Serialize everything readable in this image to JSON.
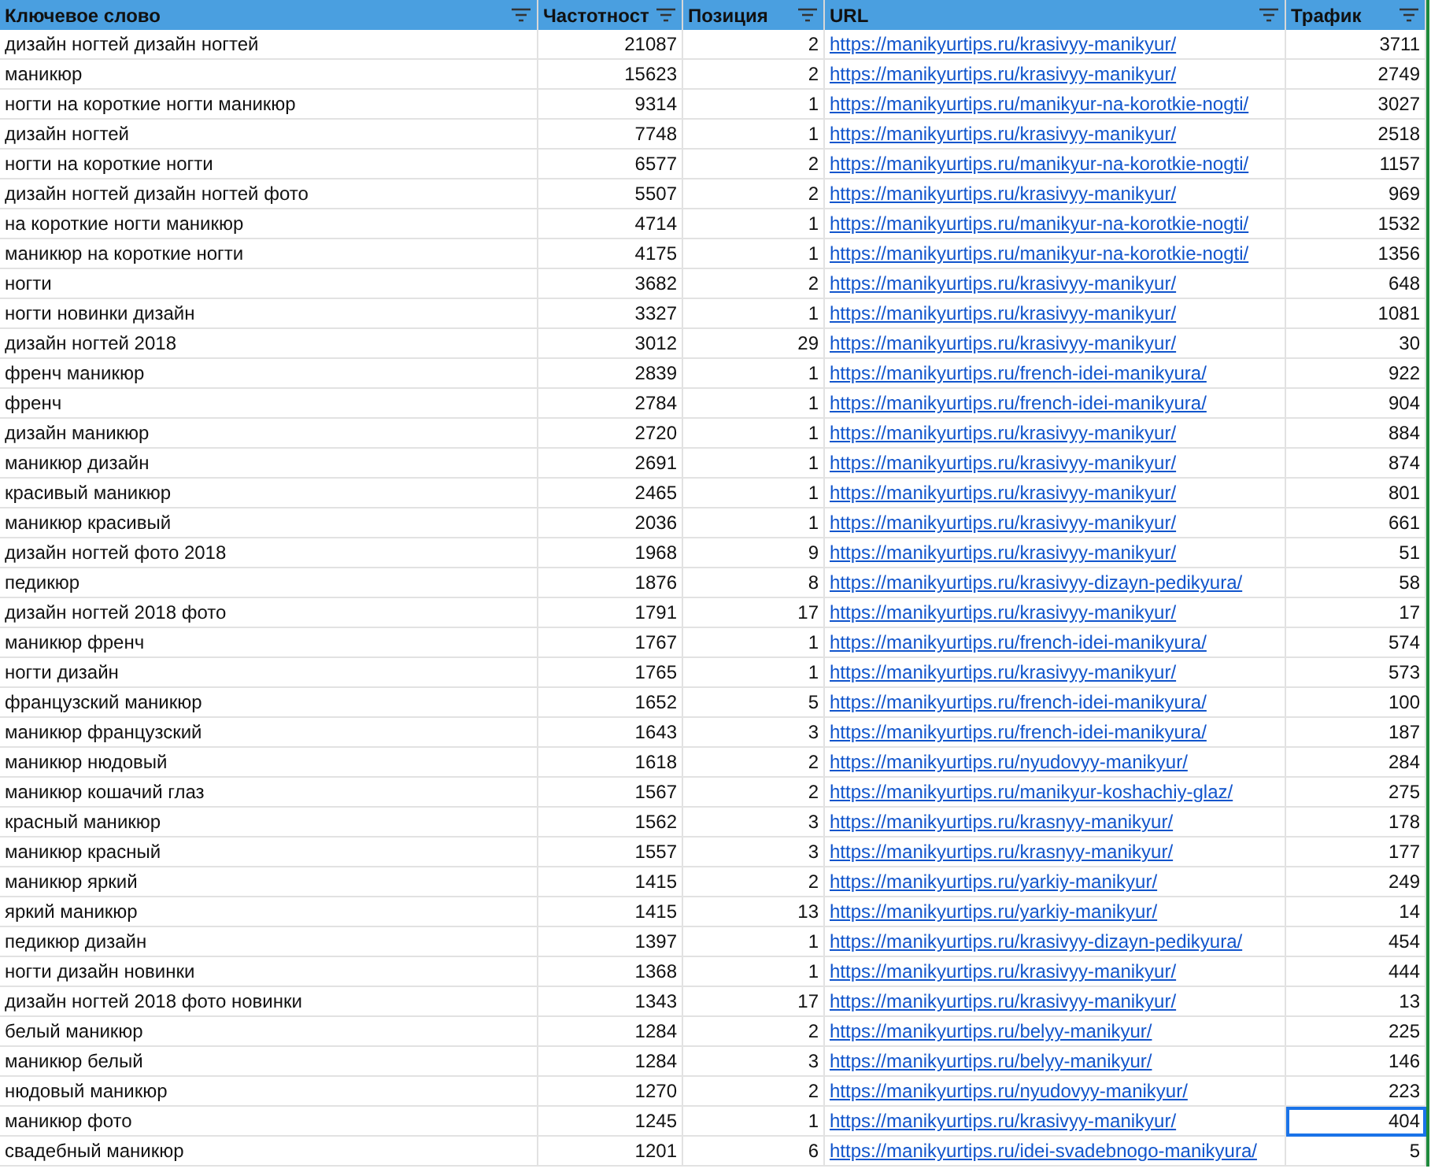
{
  "columns": [
    {
      "label": "Ключевое слово",
      "kind": "text"
    },
    {
      "label": "Частотност",
      "kind": "number"
    },
    {
      "label": "Позиция",
      "kind": "number"
    },
    {
      "label": "URL",
      "kind": "link"
    },
    {
      "label": "Трафик",
      "kind": "number"
    }
  ],
  "rows": [
    {
      "cells": [
        "дизайн ногтей дизайн ногтей",
        "21087",
        "2",
        "https://manikyurtips.ru/krasivyy-manikyur/",
        "3711"
      ],
      "selected": false
    },
    {
      "cells": [
        "маникюр",
        "15623",
        "2",
        "https://manikyurtips.ru/krasivyy-manikyur/",
        "2749"
      ],
      "selected": false
    },
    {
      "cells": [
        "ногти на короткие ногти маникюр",
        "9314",
        "1",
        "https://manikyurtips.ru/manikyur-na-korotkie-nogti/",
        "3027"
      ],
      "selected": false
    },
    {
      "cells": [
        "дизайн ногтей",
        "7748",
        "1",
        "https://manikyurtips.ru/krasivyy-manikyur/",
        "2518"
      ],
      "selected": false
    },
    {
      "cells": [
        "ногти на короткие ногти",
        "6577",
        "2",
        "https://manikyurtips.ru/manikyur-na-korotkie-nogti/",
        "1157"
      ],
      "selected": false
    },
    {
      "cells": [
        "дизайн ногтей дизайн ногтей фото",
        "5507",
        "2",
        "https://manikyurtips.ru/krasivyy-manikyur/",
        "969"
      ],
      "selected": false
    },
    {
      "cells": [
        "на короткие ногти маникюр",
        "4714",
        "1",
        "https://manikyurtips.ru/manikyur-na-korotkie-nogti/",
        "1532"
      ],
      "selected": false
    },
    {
      "cells": [
        "маникюр на короткие ногти",
        "4175",
        "1",
        "https://manikyurtips.ru/manikyur-na-korotkie-nogti/",
        "1356"
      ],
      "selected": false
    },
    {
      "cells": [
        "ногти",
        "3682",
        "2",
        "https://manikyurtips.ru/krasivyy-manikyur/",
        "648"
      ],
      "selected": false
    },
    {
      "cells": [
        "ногти новинки дизайн",
        "3327",
        "1",
        "https://manikyurtips.ru/krasivyy-manikyur/",
        "1081"
      ],
      "selected": false
    },
    {
      "cells": [
        "дизайн ногтей 2018",
        "3012",
        "29",
        "https://manikyurtips.ru/krasivyy-manikyur/",
        "30"
      ],
      "selected": false
    },
    {
      "cells": [
        "френч маникюр",
        "2839",
        "1",
        "https://manikyurtips.ru/french-idei-manikyura/",
        "922"
      ],
      "selected": false
    },
    {
      "cells": [
        "френч",
        "2784",
        "1",
        "https://manikyurtips.ru/french-idei-manikyura/",
        "904"
      ],
      "selected": false
    },
    {
      "cells": [
        "дизайн маникюр",
        "2720",
        "1",
        "https://manikyurtips.ru/krasivyy-manikyur/",
        "884"
      ],
      "selected": false
    },
    {
      "cells": [
        "маникюр дизайн",
        "2691",
        "1",
        "https://manikyurtips.ru/krasivyy-manikyur/",
        "874"
      ],
      "selected": false
    },
    {
      "cells": [
        "красивый маникюр",
        "2465",
        "1",
        "https://manikyurtips.ru/krasivyy-manikyur/",
        "801"
      ],
      "selected": false
    },
    {
      "cells": [
        "маникюр красивый",
        "2036",
        "1",
        "https://manikyurtips.ru/krasivyy-manikyur/",
        "661"
      ],
      "selected": false
    },
    {
      "cells": [
        "дизайн ногтей фото 2018",
        "1968",
        "9",
        "https://manikyurtips.ru/krasivyy-manikyur/",
        "51"
      ],
      "selected": false
    },
    {
      "cells": [
        "педикюр",
        "1876",
        "8",
        "https://manikyurtips.ru/krasivyy-dizayn-pedikyura/",
        "58"
      ],
      "selected": false
    },
    {
      "cells": [
        "дизайн ногтей 2018 фото",
        "1791",
        "17",
        "https://manikyurtips.ru/krasivyy-manikyur/",
        "17"
      ],
      "selected": false
    },
    {
      "cells": [
        "маникюр френч",
        "1767",
        "1",
        "https://manikyurtips.ru/french-idei-manikyura/",
        "574"
      ],
      "selected": false
    },
    {
      "cells": [
        "ногти дизайн",
        "1765",
        "1",
        "https://manikyurtips.ru/krasivyy-manikyur/",
        "573"
      ],
      "selected": false
    },
    {
      "cells": [
        "французский маникюр",
        "1652",
        "5",
        "https://manikyurtips.ru/french-idei-manikyura/",
        "100"
      ],
      "selected": false
    },
    {
      "cells": [
        "маникюр французский",
        "1643",
        "3",
        "https://manikyurtips.ru/french-idei-manikyura/",
        "187"
      ],
      "selected": false
    },
    {
      "cells": [
        "маникюр нюдовый",
        "1618",
        "2",
        "https://manikyurtips.ru/nyudovyy-manikyur/",
        "284"
      ],
      "selected": false
    },
    {
      "cells": [
        "маникюр кошачий глаз",
        "1567",
        "2",
        "https://manikyurtips.ru/manikyur-koshachiy-glaz/",
        "275"
      ],
      "selected": false
    },
    {
      "cells": [
        "красный маникюр",
        "1562",
        "3",
        "https://manikyurtips.ru/krasnyy-manikyur/",
        "178"
      ],
      "selected": false
    },
    {
      "cells": [
        "маникюр красный",
        "1557",
        "3",
        "https://manikyurtips.ru/krasnyy-manikyur/",
        "177"
      ],
      "selected": false
    },
    {
      "cells": [
        "маникюр яркий",
        "1415",
        "2",
        "https://manikyurtips.ru/yarkiy-manikyur/",
        "249"
      ],
      "selected": false
    },
    {
      "cells": [
        "яркий маникюр",
        "1415",
        "13",
        "https://manikyurtips.ru/yarkiy-manikyur/",
        "14"
      ],
      "selected": false
    },
    {
      "cells": [
        "педикюр дизайн",
        "1397",
        "1",
        "https://manikyurtips.ru/krasivyy-dizayn-pedikyura/",
        "454"
      ],
      "selected": false
    },
    {
      "cells": [
        "ногти дизайн новинки",
        "1368",
        "1",
        "https://manikyurtips.ru/krasivyy-manikyur/",
        "444"
      ],
      "selected": false
    },
    {
      "cells": [
        "дизайн ногтей 2018 фото новинки",
        "1343",
        "17",
        "https://manikyurtips.ru/krasivyy-manikyur/",
        "13"
      ],
      "selected": false
    },
    {
      "cells": [
        "белый маникюр",
        "1284",
        "2",
        "https://manikyurtips.ru/belyy-manikyur/",
        "225"
      ],
      "selected": false
    },
    {
      "cells": [
        "маникюр белый",
        "1284",
        "3",
        "https://manikyurtips.ru/belyy-manikyur/",
        "146"
      ],
      "selected": false
    },
    {
      "cells": [
        "нюдовый маникюр",
        "1270",
        "2",
        "https://manikyurtips.ru/nyudovyy-manikyur/",
        "223"
      ],
      "selected": false
    },
    {
      "cells": [
        "маникюр фото",
        "1245",
        "1",
        "https://manikyurtips.ru/krasivyy-manikyur/",
        "404"
      ],
      "selected": true
    },
    {
      "cells": [
        "свадебный маникюр",
        "1201",
        "6",
        "https://manikyurtips.ru/idei-svadebnogo-manikyura/",
        "5"
      ],
      "selected": false
    }
  ]
}
